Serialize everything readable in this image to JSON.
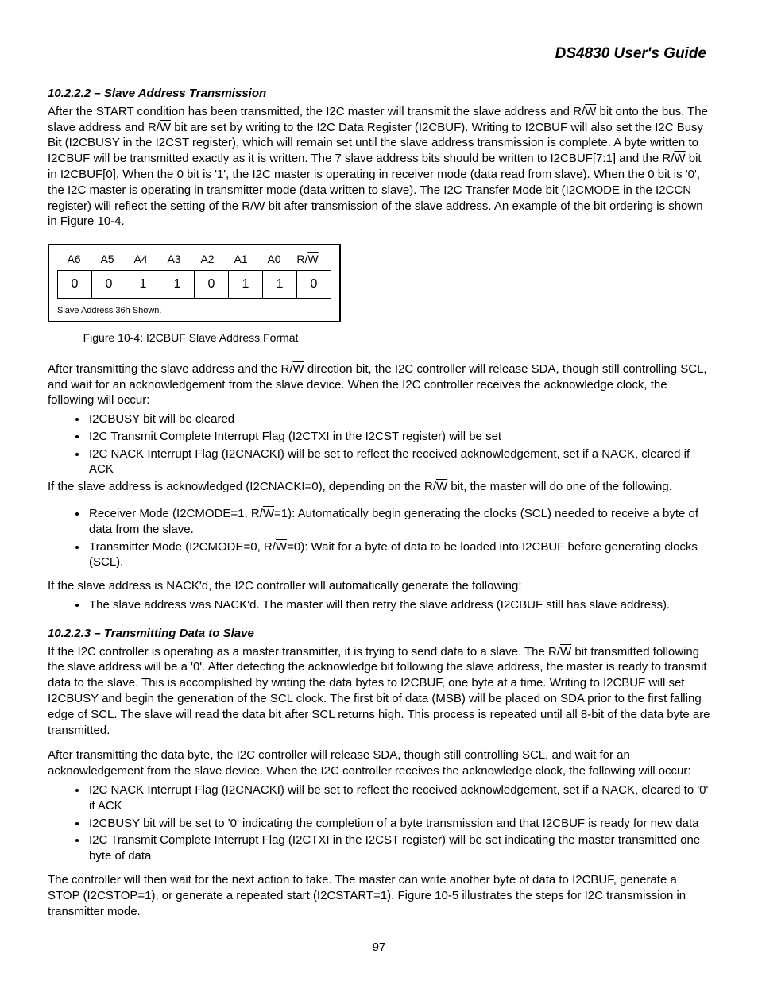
{
  "header": {
    "title": "DS4830 User's Guide"
  },
  "sec1": {
    "heading": "10.2.2.2 – Slave Address Transmission",
    "p1_a": "After the START condition has been transmitted, the I2C master will transmit the slave address and R/",
    "p1_b": " bit onto the bus. The slave address and R/",
    "p1_c": " bit are set by writing to the I2C Data Register (I2CBUF). Writing to I2CBUF will also set the I2C Busy Bit (I2CBUSY in the I2CST register), which will remain set until the slave address transmission is complete. A byte written to I2CBUF will be transmitted exactly as it is written. The 7 slave address bits should be written to I2CBUF[7:1] and the R/",
    "p1_d": " bit in I2CBUF[0]. When the 0 bit is '1', the I2C master is operating in receiver mode (data read from slave). When the 0 bit is '0', the I2C master is operating in transmitter mode (data written to slave). The I2C Transfer Mode bit (I2CMODE in the I2CCN register) will reflect the setting of the R/",
    "p1_e": " bit after transmission of the slave address. An example of the bit ordering is shown in Figure 10-4."
  },
  "fig": {
    "headers": [
      "A6",
      "A5",
      "A4",
      "A3",
      "A2",
      "A1",
      "A0",
      "R/W"
    ],
    "cells": [
      "0",
      "0",
      "1",
      "1",
      "0",
      "1",
      "1",
      "0"
    ],
    "inner_caption": "Slave Address 36h Shown.",
    "num": "Figure 10-4:",
    "label": "I2CBUF Slave Address Format"
  },
  "after_fig": {
    "p2_a": "After transmitting the slave address and the R/",
    "p2_b": " direction bit, the I2C controller will release SDA, though still controlling SCL, and wait for an acknowledgement from the slave device. When the I2C controller receives the acknowledge clock, the following will occur:"
  },
  "list_a": {
    "li1": "I2CBUSY bit will be cleared",
    "li2": "I2C Transmit Complete Interrupt Flag (I2CTXI in the I2CST register) will be set",
    "li3": "I2C NACK Interrupt Flag (I2CNACKI) will be set to reflect the received acknowledgement, set if a NACK, cleared if ACK",
    "p_after_a": "If the slave address is acknowledged (I2CNACKI=0), depending on the R/",
    "p_after_b": " bit, the master will do one of the following."
  },
  "list_b": {
    "li1_a": "Receiver Mode (I2CMODE=1, R/",
    "li1_b": "=1): Automatically begin generating the clocks (SCL) needed to receive a byte of data from the slave.",
    "li2_a": "Transmitter Mode (I2CMODE=0, R/",
    "li2_b": "=0): Wait for a byte of data to be loaded into I2CBUF before generating clocks (SCL)."
  },
  "nack_para": "If the slave address is NACK'd, the I2C controller will automatically generate the following:",
  "list_c": {
    "li1": "The slave address was NACK'd. The master will then retry the slave address (I2CBUF still has slave address)."
  },
  "sec2": {
    "heading": "10.2.2.3 – Transmitting Data to Slave",
    "p1_a": "If the I2C controller is operating as a master transmitter, it is trying to send data to a slave. The R/",
    "p1_b": " bit transmitted following the slave address will be a '0'. After detecting the acknowledge bit following the slave address, the master is ready to transmit data to the slave. This is accomplished by writing the data bytes to I2CBUF, one byte at a time. Writing to I2CBUF will set I2CBUSY and begin the generation of the SCL clock. The first bit of data (MSB) will be placed on SDA prior to the first falling edge of SCL. The slave will read the data bit after SCL returns high. This process is repeated until all 8-bit of the data byte are transmitted.",
    "p2": "After transmitting the data byte, the I2C controller will release SDA, though still controlling SCL, and wait for an acknowledgement from the slave device. When the I2C controller receives the acknowledge clock, the following will occur:"
  },
  "list_d": {
    "li1": "I2C NACK Interrupt Flag (I2CNACKI) will be set to reflect the received acknowledgement, set if a NACK, cleared to '0' if ACK",
    "li2": "I2CBUSY bit will be set to '0' indicating the completion of a byte transmission and that I2CBUF is ready for new data",
    "li3": "I2C Transmit Complete Interrupt Flag (I2CTXI in the I2CST register) will be set indicating the master transmitted one byte of data"
  },
  "last_para": "The controller will then wait for the next action to take. The master can write another byte of data to I2CBUF, generate a STOP (I2CSTOP=1), or generate a repeated start (I2CSTART=1). Figure 10-5 illustrates the steps for I2C transmission in transmitter mode.",
  "page_number": "97"
}
